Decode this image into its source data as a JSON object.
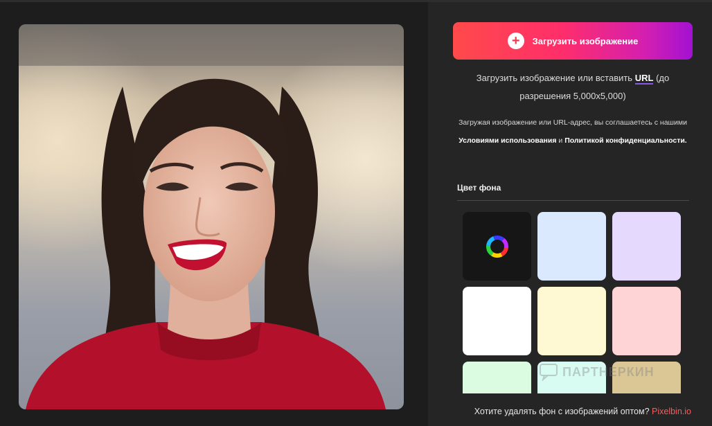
{
  "upload": {
    "button_label": "Загрузить изображение",
    "plus_icon": "plus-icon"
  },
  "hint": {
    "prefix": "Загрузить изображение или вставить",
    "url_label": "URL",
    "suffix": "(до разрешения 5,000x5,000)"
  },
  "terms": {
    "prefix": "Загружая изображение или URL-адрес, вы соглашаетесь с нашими",
    "terms_link": "Условиями использования",
    "and": "и",
    "privacy_link": "Политикой конфиденциальности."
  },
  "background": {
    "title": "Цвет фона",
    "picker_icon": "color-wheel-icon",
    "swatches": [
      "#dbe9fe",
      "#e5dafd",
      "#ffffff",
      "#fef8d3",
      "#fed4d6",
      "#dcfce1",
      "#d8fbf2",
      "#dbc796"
    ]
  },
  "watermark": {
    "text": "ПАРТНЕРКИН"
  },
  "bulk": {
    "text": "Хотите удалять фон с изображений оптом?",
    "link": "Pixelbin.io"
  }
}
